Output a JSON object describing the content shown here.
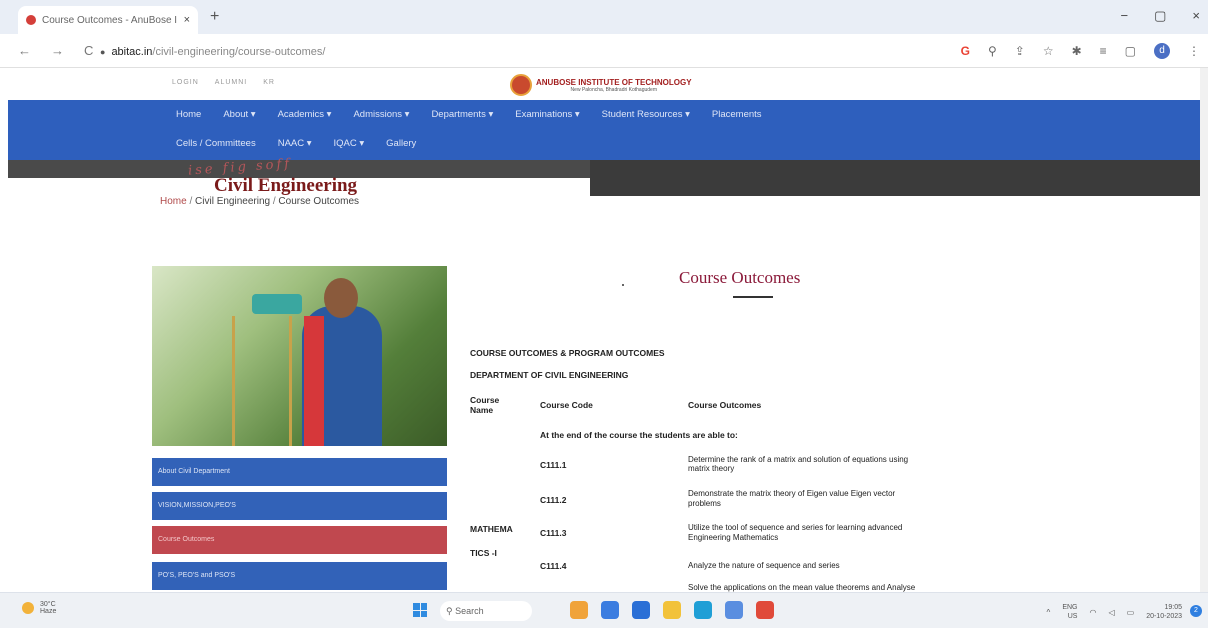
{
  "browser": {
    "tab_title": "Course Outcomes - AnuBose I",
    "tab_close": "×",
    "new_tab": "+",
    "back": "←",
    "forward": "→",
    "reload": "C",
    "url_host": "abitac.in",
    "url_path": "/civil-engineering/course-outcomes/",
    "window": {
      "minimize": "−",
      "restore": "▢",
      "close": "×"
    },
    "profile_initial": "d"
  },
  "site": {
    "top_links": [
      "LOGIN",
      "ALUMNI",
      "KR"
    ],
    "logo_title": "ANUBOSE INSTITUTE OF TECHNOLOGY",
    "logo_sub": "New Paloncha, Bhadradri Kothagudem",
    "menu_row1": [
      "Home",
      "About ▾",
      "Academics ▾",
      "Admissions ▾",
      "Departments ▾",
      "Examinations ▾",
      "Student Resources ▾",
      "Placements"
    ],
    "menu_row2": [
      "Cells / Committees",
      "NAAC ▾",
      "IQAC ▾",
      "Gallery"
    ],
    "banner_scribble": "ise fig soff",
    "page_title": "Civil Engineering",
    "breadcrumb": {
      "home": "Home",
      "sep1": " / ",
      "section": "Civil Engineering",
      "sep2": " / ",
      "current": "Course Outcomes"
    }
  },
  "sidebar": {
    "items": [
      "About Civil Department",
      "VISION,MISSION,PEO'S",
      "Course Outcomes",
      "PO'S, PEO'S and PSO'S"
    ],
    "active_index": 2
  },
  "content": {
    "heading": "Course Outcomes",
    "line1": "COURSE OUTCOMES & PROGRAM OUTCOMES",
    "line2": "DEPARTMENT OF CIVIL  ENGINEERING",
    "col_name_1": "Course",
    "col_name_2": "Name",
    "col_code": "Course Code",
    "col_outcomes": "Course Outcomes",
    "intro": "At the end of the course the students are able to:",
    "subject_1": "MATHEMA",
    "subject_2": "TICS -I",
    "rows": [
      {
        "code": "C111.1",
        "line1": "Determine the rank of a matrix and solution of equations using",
        "line2": "matrix theory"
      },
      {
        "code": "C111.2",
        "line1": "Demonstrate the matrix theory of Eigen value Eigen vector",
        "line2": "problems"
      },
      {
        "code": "C111.3",
        "line1": "Utilize the tool of sequence and series for learning advanced",
        "line2": "Engineering Mathematics"
      },
      {
        "code": "C111.4",
        "line1": "Analyze the nature of sequence and series",
        "line2": ""
      },
      {
        "code": "",
        "line1": "Solve the applications on the mean value theorems and Analyse",
        "line2": ""
      }
    ]
  },
  "taskbar": {
    "temp": "30°C",
    "condition": "Haze",
    "search": "Search",
    "lang1": "ENG",
    "lang2": "US",
    "time": "19:05",
    "date": "20-10-2023",
    "notifications": "2"
  }
}
